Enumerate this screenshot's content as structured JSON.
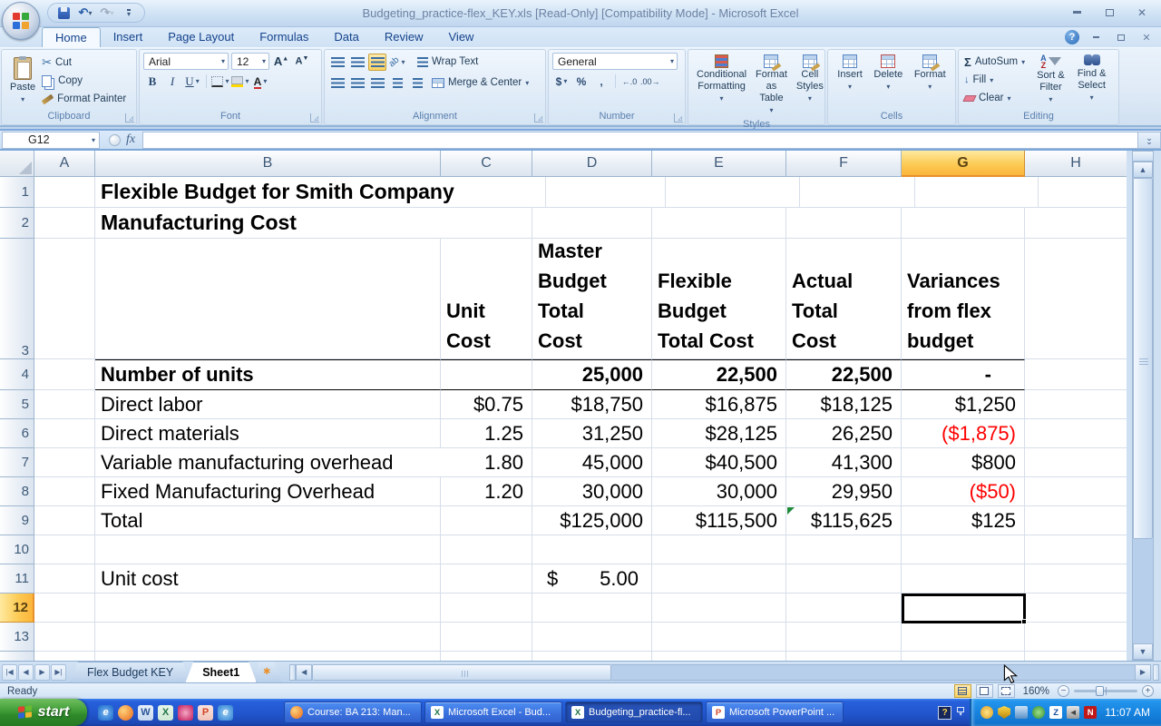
{
  "window": {
    "title": "Budgeting_practice-flex_KEY.xls  [Read-Only]  [Compatibility Mode] - Microsoft Excel"
  },
  "ribbon": {
    "tabs": [
      "Home",
      "Insert",
      "Page Layout",
      "Formulas",
      "Data",
      "Review",
      "View"
    ],
    "clipboard": {
      "label": "Clipboard",
      "paste": "Paste",
      "cut": "Cut",
      "copy": "Copy",
      "format_painter": "Format Painter"
    },
    "font": {
      "label": "Font",
      "font_name": "Arial",
      "font_size": "12"
    },
    "alignment": {
      "label": "Alignment",
      "wrap_text": "Wrap Text",
      "merge_center": "Merge & Center"
    },
    "number": {
      "label": "Number",
      "format": "General"
    },
    "styles": {
      "label": "Styles",
      "conditional": "Conditional\nFormatting",
      "format_as_table": "Format\nas Table",
      "cell_styles": "Cell\nStyles"
    },
    "cells": {
      "label": "Cells",
      "insert": "Insert",
      "delete": "Delete",
      "format": "Format"
    },
    "editing": {
      "label": "Editing",
      "autosum": "AutoSum",
      "fill": "Fill",
      "clear": "Clear",
      "sort_filter": "Sort &\nFilter",
      "find_select": "Find &\nSelect"
    }
  },
  "formula_bar": {
    "name_box": "G12",
    "fx": "fx",
    "formula": ""
  },
  "sheet": {
    "columns": [
      "A",
      "B",
      "C",
      "D",
      "E",
      "F",
      "G",
      "H"
    ],
    "rows": [
      "1",
      "2",
      "3",
      "4",
      "5",
      "6",
      "7",
      "8",
      "9",
      "10",
      "11",
      "12",
      "13"
    ],
    "selected_cell": "G12",
    "title_line1": "Flexible Budget for Smith Company",
    "title_line2": "Manufacturing Cost",
    "headers": {
      "unit_cost": "Unit\nCost",
      "master_budget": "Master\nBudget\nTotal\nCost",
      "flexible_budget": "Flexible\nBudget\nTotal Cost",
      "actual": "Actual\nTotal\nCost",
      "variances": "Variances\nfrom flex\nbudget"
    },
    "table": [
      {
        "label": "Number of units",
        "unit_cost": "",
        "master": "25,000",
        "flexible": "22,500",
        "actual": "22,500",
        "variance": "-"
      },
      {
        "label": "Direct labor",
        "unit_cost": "$0.75",
        "master": "$18,750",
        "flexible": "$16,875",
        "actual": "$18,125",
        "variance": "$1,250"
      },
      {
        "label": "Direct materials",
        "unit_cost": "1.25",
        "master": "31,250",
        "flexible": "$28,125",
        "actual": "26,250",
        "variance": "($1,875)"
      },
      {
        "label": "Variable manufacturing overhead",
        "unit_cost": "1.80",
        "master": "45,000",
        "flexible": "$40,500",
        "actual": "41,300",
        "variance": "$800"
      },
      {
        "label": "Fixed Manufacturing Overhead",
        "unit_cost": "1.20",
        "master": "30,000",
        "flexible": "30,000",
        "actual": "29,950",
        "variance": "($50)"
      },
      {
        "label": "Total",
        "unit_cost": "",
        "master": "$125,000",
        "flexible": "$115,500",
        "actual": "$115,625",
        "variance": "$125"
      }
    ],
    "unit_cost_row": {
      "label": "Unit cost",
      "currency": "$",
      "value": "5.00"
    }
  },
  "sheet_tabs": {
    "tabs": [
      "Flex Budget KEY",
      "Sheet1"
    ],
    "active": "Sheet1"
  },
  "status_bar": {
    "mode": "Ready",
    "zoom_level": "160%"
  },
  "taskbar": {
    "start_label": "start",
    "buttons": [
      "Course: BA 213: Man...",
      "Microsoft Excel - Bud...",
      "Budgeting_practice-fl...",
      "Microsoft PowerPoint ..."
    ],
    "clock": "11:07 AM"
  },
  "colors": {
    "accent_selection": "#fbb43a",
    "negative": "#ff0000",
    "grid_line": "#d6dee9",
    "taskbar_blue": "#2155cd"
  }
}
